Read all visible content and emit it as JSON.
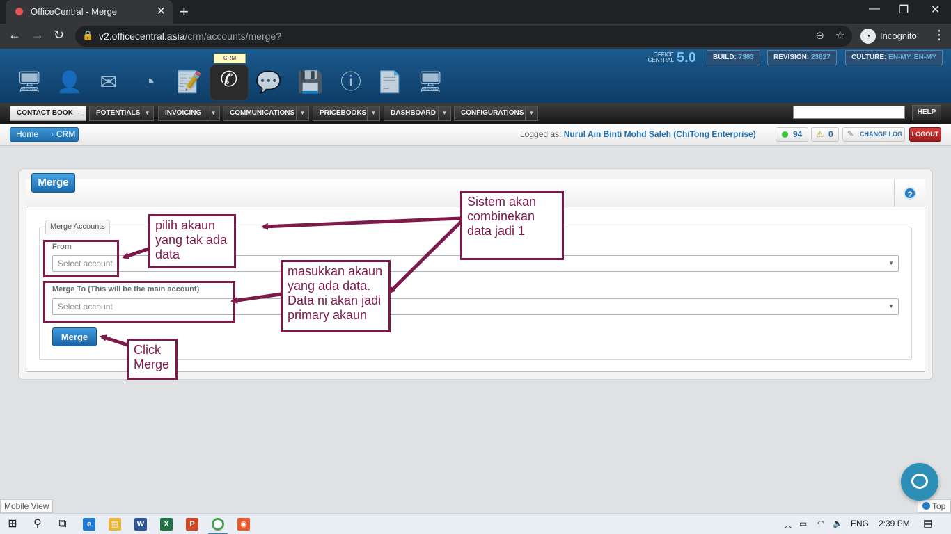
{
  "browser": {
    "tab_title": "OfficeCentral - Merge",
    "url_host": "v2.officecentral.asia",
    "url_path": "/crm/accounts/merge?",
    "profile": "Incognito",
    "icons": [
      "back-icon",
      "forward-icon",
      "reload-icon",
      "lock-icon",
      "zoom-icon",
      "star-icon",
      "incognito-icon",
      "kebab-menu-icon"
    ]
  },
  "header": {
    "active_module": "CRM",
    "logo_small": "OFFICE CENTRAL",
    "logo_version": "5.0",
    "build_label": "BUILD:",
    "build_value": "7383",
    "revision_label": "REVISION:",
    "revision_value": "23627",
    "culture_label": "CULTURE:",
    "culture_value": "EN-MY, EN-MY"
  },
  "menu": {
    "items": [
      "CONTACT BOOK",
      "POTENTIALS",
      "INVOICING",
      "COMMUNICATIONS",
      "PRICEBOOKS",
      "DASHBOARD",
      "CONFIGURATIONS"
    ],
    "help": "HELP"
  },
  "crumbs": {
    "home": "Home",
    "crm": "CRM",
    "logged_label": "Logged as:",
    "user": "Nurul Ain Binti Mohd Saleh (ChiTong Enterprise)",
    "online_count": "94",
    "alert_count": "0",
    "change_log": "CHANGE LOG",
    "logout": "LOGOUT"
  },
  "panel": {
    "title": "Merge",
    "legend": "Merge Accounts",
    "from_label": "From",
    "from_placeholder": "Select account",
    "to_label": "Merge To (This will be the main account)",
    "to_placeholder": "Select account",
    "button": "Merge"
  },
  "annotations": {
    "pilih": [
      "pilih akaun",
      "yang tak ada",
      "data"
    ],
    "sistem": [
      "Sistem akan",
      "combinekan",
      "data jadi 1"
    ],
    "masukkan": [
      "masukkan akaun",
      "yang ada data.",
      "Data ni akan jadi",
      "primary akaun"
    ],
    "click": [
      "Click",
      "Merge"
    ],
    "color": "#7d1a4a"
  },
  "footer": {
    "mobile_view": "Mobile View",
    "top": "Top"
  },
  "taskbar": {
    "language": "ENG",
    "time": "2:39 PM"
  }
}
